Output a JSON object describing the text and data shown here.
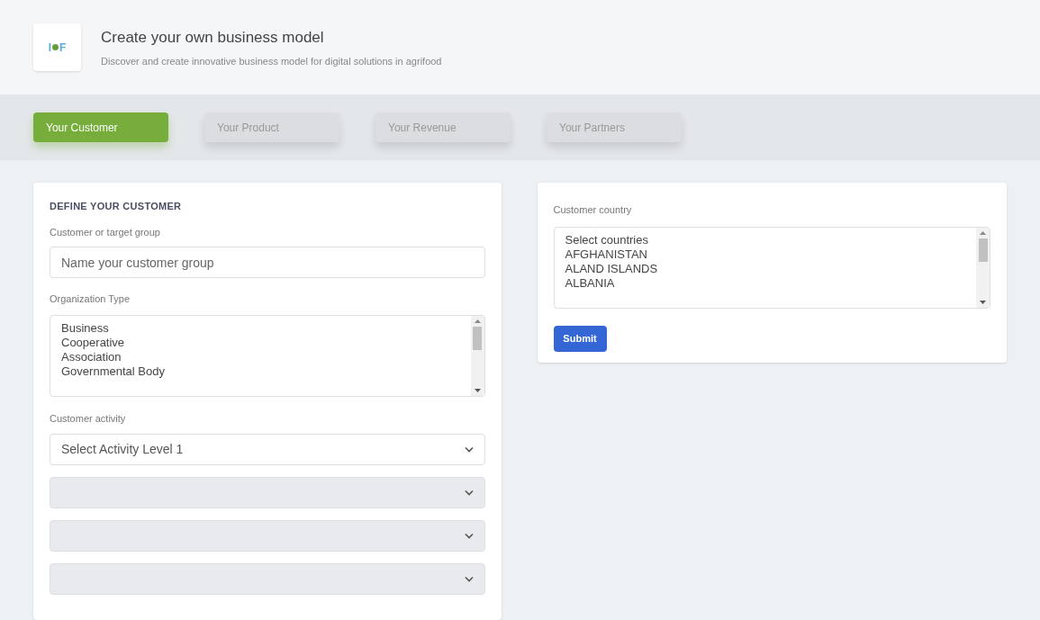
{
  "header": {
    "logo": {
      "left": "I",
      "right": "F"
    },
    "title": "Create your own business model",
    "subtitle": "Discover and create innovative business model for digital solutions in agrifood"
  },
  "tabs": [
    {
      "label": "Your Customer",
      "selected": true
    },
    {
      "label": "Your Product",
      "selected": false
    },
    {
      "label": "Your Revenue",
      "selected": false
    },
    {
      "label": "Your Partners",
      "selected": false
    }
  ],
  "customer_card": {
    "heading": "DEFINE YOUR CUSTOMER",
    "target_label": "Customer or target group",
    "target_placeholder": "Name your customer group",
    "org_label": "Organization Type",
    "org_options": [
      "Business",
      "Cooperative",
      "Association",
      "Governmental Body"
    ],
    "activity_label": "Customer activity",
    "activity_selects": [
      {
        "value": "Select Activity Level 1",
        "disabled": false
      },
      {
        "disabled": true
      },
      {
        "disabled": true
      },
      {
        "disabled": true
      }
    ]
  },
  "country_card": {
    "label": "Customer country",
    "options": [
      "Select countries",
      "AFGHANISTAN",
      "ALAND ISLANDS",
      "ALBANIA"
    ],
    "submit": "Submit"
  }
}
